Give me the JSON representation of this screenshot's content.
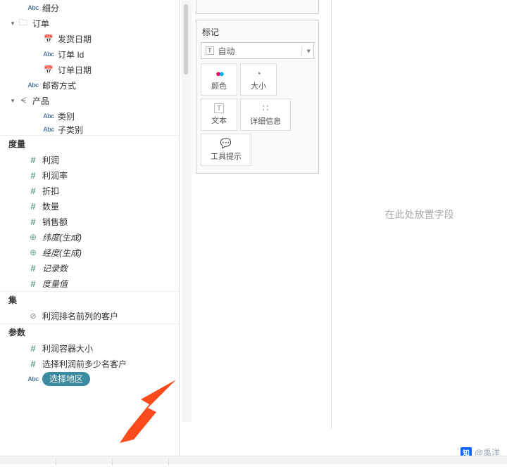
{
  "dimensions": {
    "xifen": "细分",
    "folder_order": "订单",
    "ship_date": "发货日期",
    "order_id": "订单 Id",
    "order_date": "订单日期",
    "ship_mode": "邮寄方式",
    "folder_product": "产品",
    "category": "类别",
    "subcategory": "子类别"
  },
  "sections": {
    "measure": "度量",
    "set": "集",
    "param": "参数"
  },
  "measures": {
    "profit": "利润",
    "profit_rate": "利润率",
    "discount": "折扣",
    "quantity": "数量",
    "sales": "销售额",
    "latitude": "纬度(生成)",
    "longitude": "经度(生成)",
    "records": "记录数",
    "measure_values": "度量值"
  },
  "sets": {
    "top_profit_customers": "利润排名前列的客户"
  },
  "params": {
    "bin_size": "利润容器大小",
    "top_n_customers": "选择利润前多少名客户",
    "select_region": "选择地区"
  },
  "marks": {
    "title": "标记",
    "auto": "自动",
    "color": "颜色",
    "size": "大小",
    "text": "文本",
    "detail": "详细信息",
    "tooltip": "工具提示"
  },
  "canvas": {
    "placeholder": "在此处放置字段"
  },
  "watermark": {
    "site": "知",
    "author": "@禹洋"
  },
  "icons": {
    "abc": "Abc",
    "t_box": "T"
  }
}
